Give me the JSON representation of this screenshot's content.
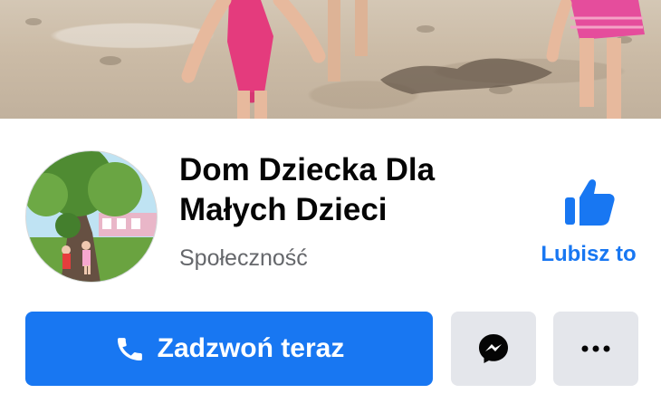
{
  "page": {
    "name": "Dom Dziecka Dla Małych Dzieci",
    "category": "Społeczność"
  },
  "actions": {
    "like_label": "Lubisz to",
    "call_label": "Zadzwoń teraz"
  },
  "icons": {
    "cover": "cover-photo",
    "avatar": "profile-picture",
    "like": "thumbs-up-icon",
    "phone": "phone-icon",
    "messenger": "messenger-icon",
    "more": "more-icon"
  },
  "colors": {
    "accent": "#1877f2",
    "muted": "#65676b",
    "button_gray": "#e4e6eb"
  }
}
